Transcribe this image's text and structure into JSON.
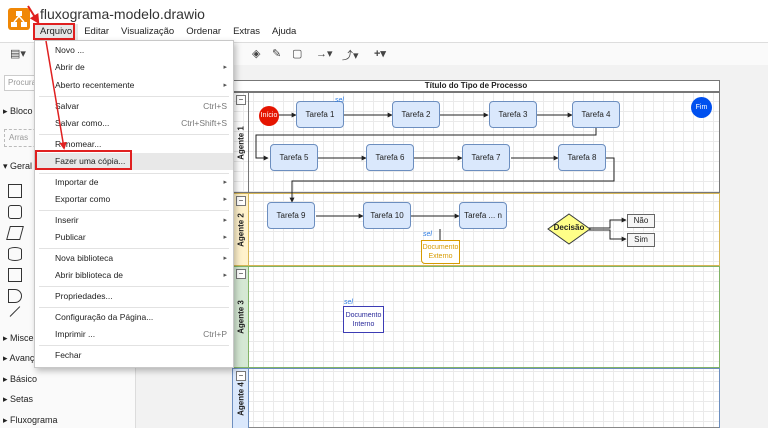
{
  "window": {
    "title": "fluxograma-modelo.drawio"
  },
  "menubar": [
    "Arquivo",
    "Editar",
    "Visualização",
    "Ordenar",
    "Extras",
    "Ajuda"
  ],
  "sidebar": {
    "search_placeholder": "Procurar",
    "sections": [
      "Bloco de",
      "Geral",
      "Miscelâ",
      "Avança",
      "Básico",
      "Setas",
      "Fluxograma"
    ],
    "draft_placeholder": "Arras"
  },
  "file_menu": {
    "items": [
      {
        "label": "Novo ...",
        "shortcut": "",
        "submenu": false
      },
      {
        "label": "Abrir de",
        "shortcut": "",
        "submenu": true
      },
      {
        "label": "Aberto recentemente",
        "shortcut": "",
        "submenu": true
      },
      {
        "label": "Salvar",
        "shortcut": "Ctrl+S",
        "submenu": false
      },
      {
        "label": "Salvar como...",
        "shortcut": "Ctrl+Shift+S",
        "submenu": false
      },
      {
        "label": "Renomear...",
        "shortcut": "",
        "submenu": false
      },
      {
        "label": "Fazer uma cópia...",
        "shortcut": "",
        "submenu": false
      },
      {
        "label": "Importar de",
        "shortcut": "",
        "submenu": true
      },
      {
        "label": "Exportar como",
        "shortcut": "",
        "submenu": true
      },
      {
        "label": "Inserir",
        "shortcut": "",
        "submenu": true
      },
      {
        "label": "Publicar",
        "shortcut": "",
        "submenu": true
      },
      {
        "label": "Nova biblioteca",
        "shortcut": "",
        "submenu": true
      },
      {
        "label": "Abrir biblioteca de",
        "shortcut": "",
        "submenu": true
      },
      {
        "label": "Propriedades...",
        "shortcut": "",
        "submenu": false
      },
      {
        "label": "Configuração da Página...",
        "shortcut": "",
        "submenu": false
      },
      {
        "label": "Imprimir ...",
        "shortcut": "Ctrl+P",
        "submenu": false
      },
      {
        "label": "Fechar",
        "shortcut": "",
        "submenu": false
      }
    ]
  },
  "diagram": {
    "title": "Título do Tipo de Processo",
    "lanes": [
      "Agente 1",
      "Agente 2",
      "Agente 3",
      "Agente 4"
    ],
    "start": "Início",
    "end": "Fim",
    "tasks_row1": [
      "Tarefa 1",
      "Tarefa 2",
      "Tarefa 3",
      "Tarefa 4"
    ],
    "tasks_row2": [
      "Tarefa 5",
      "Tarefa 6",
      "Tarefa 7",
      "Tarefa 8"
    ],
    "tasks_row3": [
      "Tarefa 9",
      "Tarefa 10",
      "Tarefa ... n"
    ],
    "decision": "Decisão",
    "options": [
      "Não",
      "Sim"
    ],
    "doc_external": "Documento Externo",
    "doc_internal": "Documento Interno",
    "sel_tag": "sel"
  },
  "colors": {
    "accent": "#f08705",
    "highlight": "#e02020",
    "task_fill": "#dae8fc",
    "decision_fill": "#ffff88"
  }
}
